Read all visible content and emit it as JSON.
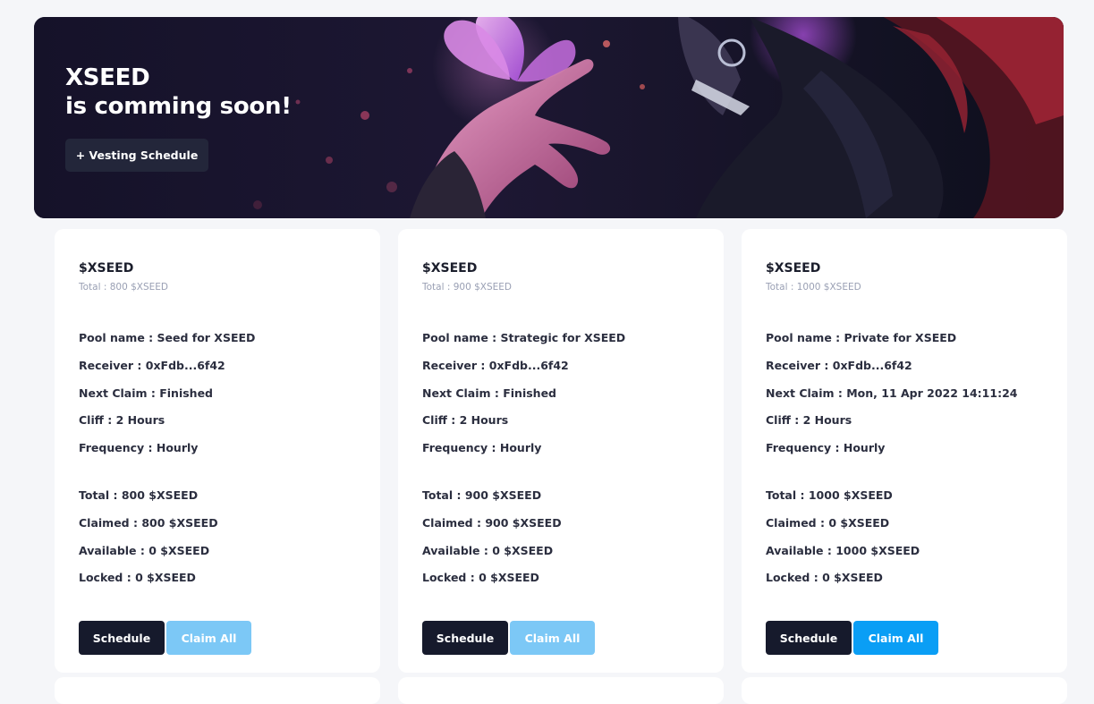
{
  "hero": {
    "title_line1": "XSEED",
    "title_line2": "is comming soon!",
    "vesting_button": "+ Vesting Schedule"
  },
  "colors": {
    "page_bg": "#f5f6f9",
    "card_bg": "#ffffff",
    "dark_button": "#161a2c",
    "claim_active": "#0a9ef5",
    "claim_disabled": "#7cc8f6",
    "muted_text": "#9aa0b4"
  },
  "cards": [
    {
      "token": "$XSEED",
      "total_caption": "Total : 800 $XSEED",
      "pool_name": "Pool name : Seed for XSEED",
      "receiver": "Receiver : 0xFdb...6f42",
      "next_claim": "Next Claim : Finished",
      "cliff": "Cliff : 2 Hours",
      "frequency": "Frequency : Hourly",
      "total": "Total : 800 $XSEED",
      "claimed": "Claimed : 800 $XSEED",
      "available": "Available : 0 $XSEED",
      "locked": "Locked : 0 $XSEED",
      "schedule_label": "Schedule",
      "claim_label": "Claim All",
      "claim_enabled": false
    },
    {
      "token": "$XSEED",
      "total_caption": "Total : 900 $XSEED",
      "pool_name": "Pool name : Strategic for XSEED",
      "receiver": "Receiver : 0xFdb...6f42",
      "next_claim": "Next Claim : Finished",
      "cliff": "Cliff : 2 Hours",
      "frequency": "Frequency : Hourly",
      "total": "Total : 900 $XSEED",
      "claimed": "Claimed : 900 $XSEED",
      "available": "Available : 0 $XSEED",
      "locked": "Locked : 0 $XSEED",
      "schedule_label": "Schedule",
      "claim_label": "Claim All",
      "claim_enabled": false
    },
    {
      "token": "$XSEED",
      "total_caption": "Total : 1000 $XSEED",
      "pool_name": "Pool name : Private for XSEED",
      "receiver": "Receiver : 0xFdb...6f42",
      "next_claim": "Next Claim : Mon, 11 Apr 2022 14:11:24",
      "cliff": "Cliff : 2 Hours",
      "frequency": "Frequency : Hourly",
      "total": "Total : 1000 $XSEED",
      "claimed": "Claimed : 0 $XSEED",
      "available": "Available : 1000 $XSEED",
      "locked": "Locked : 0 $XSEED",
      "schedule_label": "Schedule",
      "claim_label": "Claim All",
      "claim_enabled": true
    }
  ]
}
